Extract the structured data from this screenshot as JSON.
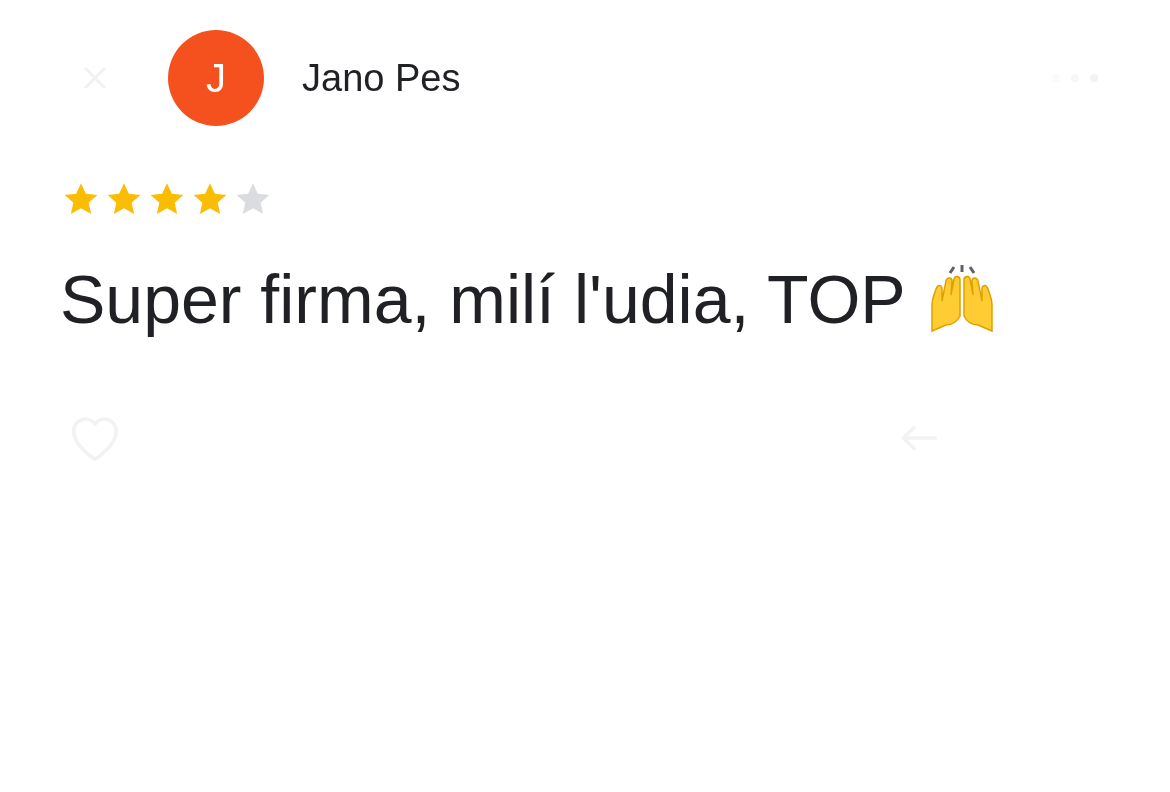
{
  "header": {
    "avatar_letter": "J",
    "author": "Jano Pes"
  },
  "review": {
    "stars": 4,
    "text": "Super firma, milí l'udia, TOP"
  }
}
